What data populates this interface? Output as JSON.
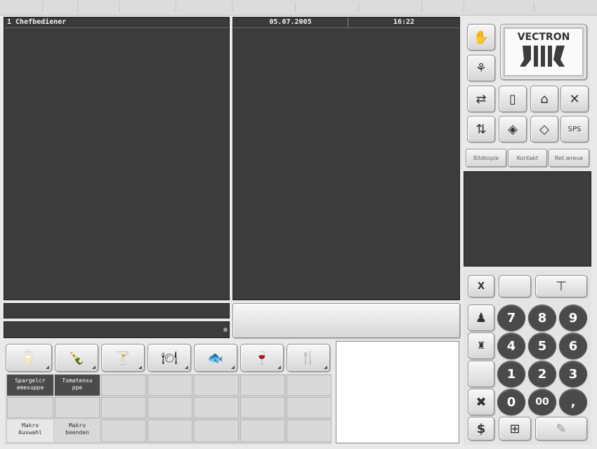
{
  "header": {
    "operator": "1  Chefbediener",
    "date": "05.07.2005",
    "time": "16:22"
  },
  "brand": {
    "logo_text": "VECTRON",
    "accent": "#3c3c3c"
  },
  "function_buttons": {
    "row1": [
      "hand-icon"
    ],
    "row2": [
      "split-icon"
    ],
    "row3": [
      "transfer-icon",
      "receipt-icon",
      "table-icon",
      "close-x-icon"
    ],
    "row4": [
      "sort-icon",
      "coupon-icon",
      "coupon2-icon",
      "sps-icon"
    ],
    "sps_label": "SPS",
    "labels": [
      "Bildkopie",
      "Kontakt",
      "Ret.wreue"
    ]
  },
  "keypad": {
    "x_label": "X",
    "keys": [
      "7",
      "8",
      "9",
      "4",
      "5",
      "6",
      "1",
      "2",
      "3",
      "0",
      "00",
      ","
    ],
    "dollar_label": "$"
  },
  "categories": [
    "drink-glass-icon",
    "bottle-icon",
    "cocktail-icon",
    "plate-icon",
    "fish-icon",
    "wine-glass-icon",
    "cutlery-icon"
  ],
  "items": {
    "item1": "Spargelcr\nemesuppe",
    "item2": "Tomatensu\nppe",
    "macro_select": "Makro\nAuswahl",
    "macro_end": "Makro\nbeenden"
  }
}
